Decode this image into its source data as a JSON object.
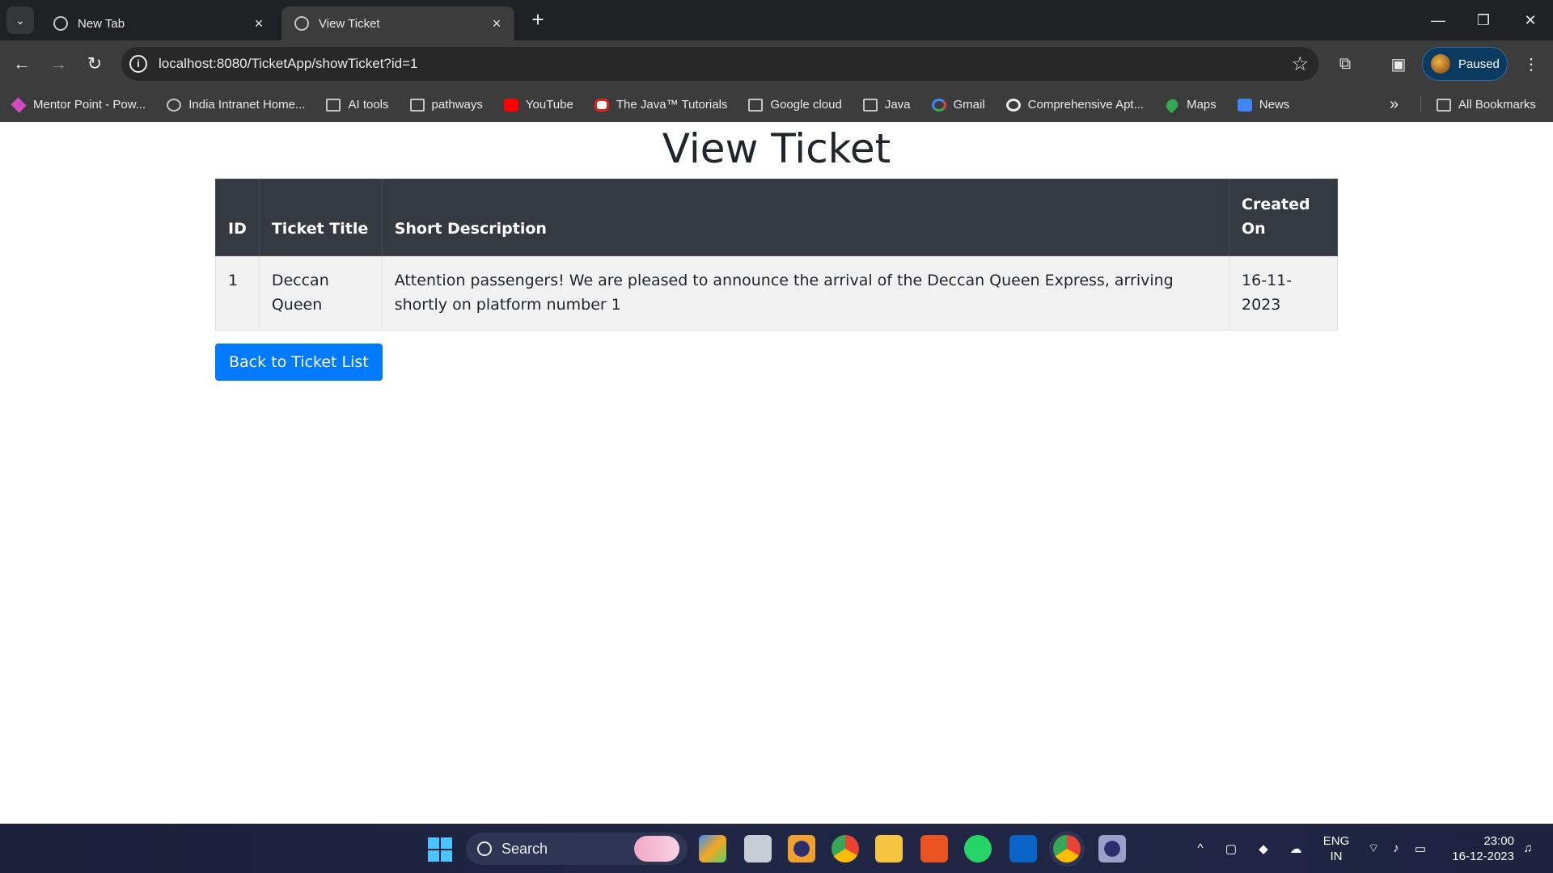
{
  "browser": {
    "tabs": [
      {
        "title": "New Tab",
        "active": false
      },
      {
        "title": "View Ticket",
        "active": true
      }
    ],
    "address_bar": {
      "url": "localhost:8080/TicketApp/showTicket?id=1"
    },
    "profile_label": "Paused",
    "bookmarks": [
      {
        "label": "Mentor Point - Pow...",
        "icon": "diamond-icon"
      },
      {
        "label": "India Intranet Home...",
        "icon": "globe-icon"
      },
      {
        "label": "AI tools",
        "icon": "folder-icon"
      },
      {
        "label": "pathways",
        "icon": "folder-icon"
      },
      {
        "label": "YouTube",
        "icon": "youtube-icon"
      },
      {
        "label": "The Java™ Tutorials",
        "icon": "oracle-icon"
      },
      {
        "label": "Google cloud",
        "icon": "folder-icon"
      },
      {
        "label": "Java",
        "icon": "folder-icon"
      },
      {
        "label": "Gmail",
        "icon": "google-icon"
      },
      {
        "label": "Comprehensive Apt...",
        "icon": "g-icon"
      },
      {
        "label": "Maps",
        "icon": "maps-icon"
      },
      {
        "label": "News",
        "icon": "news-icon"
      }
    ],
    "all_bookmarks_label": "All Bookmarks",
    "overflow_label": "»"
  },
  "page": {
    "heading": "View Ticket",
    "table": {
      "headers": [
        "ID",
        "Ticket Title",
        "Short Description",
        "Created On"
      ],
      "rows": [
        [
          "1",
          "Deccan Queen",
          "Attention passengers! We are pleased to announce the arrival of the Deccan Queen Express, arriving shortly on platform number 1",
          "16-11-2023"
        ]
      ]
    },
    "back_button_label": "Back to Ticket List"
  },
  "taskbar": {
    "search_label": "Search",
    "language": {
      "line1": "ENG",
      "line2": "IN"
    },
    "time": "23:00",
    "date": "16-12-2023"
  },
  "colors": {
    "table_header_bg": "#343a40",
    "row_bg": "#f2f2f2",
    "primary_button": "#007bff"
  }
}
